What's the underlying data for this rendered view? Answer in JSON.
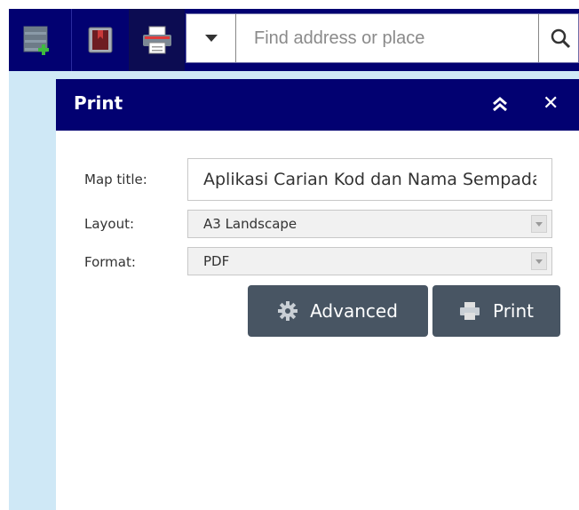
{
  "toolbar": {
    "tools": [
      {
        "name": "add-data-icon"
      },
      {
        "name": "bookmarks-icon"
      },
      {
        "name": "print-icon",
        "active": true
      }
    ]
  },
  "search": {
    "placeholder": "Find address or place",
    "value": ""
  },
  "print_panel": {
    "title": "Print",
    "collapse_symbol": "«",
    "close_symbol": "✕",
    "map_title_label": "Map title:",
    "map_title_value": "Aplikasi Carian Kod dan Nama Sempadan",
    "layout_label": "Layout:",
    "layout_value": "A3 Landscape",
    "format_label": "Format:",
    "format_value": "PDF",
    "advanced_label": "Advanced",
    "print_label": "Print"
  },
  "colors": {
    "header_bg": "#020171",
    "map_bg": "#cfe8f6",
    "button_bg": "#485563",
    "active_tool_bg": "#0c0c52"
  }
}
